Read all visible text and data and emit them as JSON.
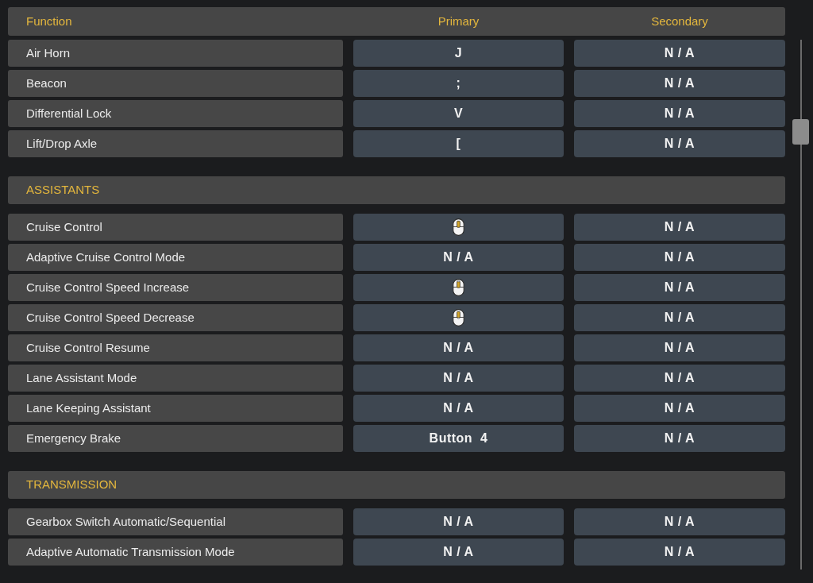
{
  "columns": [
    "Function",
    "Primary",
    "Secondary"
  ],
  "sections": [
    {
      "rows": [
        {
          "function": "Air Horn",
          "primary": {
            "kind": "text",
            "text": "J"
          },
          "secondary": {
            "kind": "text",
            "text": "N / A"
          }
        },
        {
          "function": "Beacon",
          "primary": {
            "kind": "text",
            "text": ";"
          },
          "secondary": {
            "kind": "text",
            "text": "N / A"
          }
        },
        {
          "function": "Differential Lock",
          "primary": {
            "kind": "text",
            "text": "V"
          },
          "secondary": {
            "kind": "text",
            "text": "N / A"
          }
        },
        {
          "function": "Lift/Drop Axle",
          "primary": {
            "kind": "text",
            "text": "["
          },
          "secondary": {
            "kind": "text",
            "text": "N / A"
          }
        }
      ]
    },
    {
      "title": "ASSISTANTS",
      "rows": [
        {
          "function": "Cruise Control",
          "primary": {
            "kind": "wheelclick"
          },
          "secondary": {
            "kind": "text",
            "text": "N / A"
          }
        },
        {
          "function": "Adaptive Cruise Control Mode",
          "primary": {
            "kind": "text",
            "text": "N / A"
          },
          "secondary": {
            "kind": "text",
            "text": "N / A"
          }
        },
        {
          "function": "Cruise Control Speed Increase",
          "primary": {
            "kind": "wheelup"
          },
          "secondary": {
            "kind": "text",
            "text": "N / A"
          }
        },
        {
          "function": "Cruise Control Speed Decrease",
          "primary": {
            "kind": "wheeldown"
          },
          "secondary": {
            "kind": "text",
            "text": "N / A"
          }
        },
        {
          "function": "Cruise Control Resume",
          "primary": {
            "kind": "text",
            "text": "N / A"
          },
          "secondary": {
            "kind": "text",
            "text": "N / A"
          }
        },
        {
          "function": "Lane Assistant Mode",
          "primary": {
            "kind": "text",
            "text": "N / A"
          },
          "secondary": {
            "kind": "text",
            "text": "N / A"
          }
        },
        {
          "function": "Lane Keeping Assistant",
          "primary": {
            "kind": "text",
            "text": "N / A"
          },
          "secondary": {
            "kind": "text",
            "text": "N / A"
          }
        },
        {
          "function": "Emergency Brake",
          "primary": {
            "kind": "text",
            "text": "Button  4"
          },
          "secondary": {
            "kind": "text",
            "text": "N / A"
          }
        }
      ]
    },
    {
      "title": "TRANSMISSION",
      "rows": [
        {
          "function": "Gearbox Switch Automatic/Sequential",
          "primary": {
            "kind": "text",
            "text": "N / A"
          },
          "secondary": {
            "kind": "text",
            "text": "N / A"
          }
        },
        {
          "function": "Adaptive Automatic Transmission Mode",
          "primary": {
            "kind": "text",
            "text": "N / A"
          },
          "secondary": {
            "kind": "text",
            "text": "N / A"
          }
        }
      ]
    }
  ]
}
